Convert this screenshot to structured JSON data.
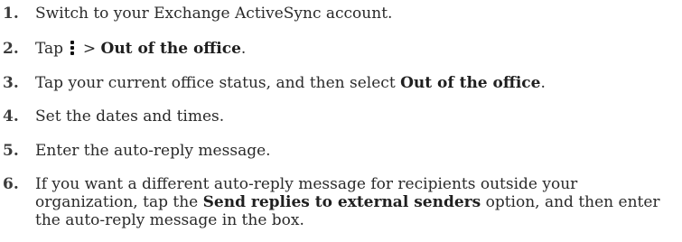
{
  "steps": [
    {
      "number": "1.",
      "text": "Switch to your Exchange ActiveSync account."
    },
    {
      "number": "2.",
      "before": "Tap ",
      "icon": "overflow-menu-icon",
      "separator": " > ",
      "bold": "Out of the office",
      "after": "."
    },
    {
      "number": "3.",
      "before": "Tap your current office status, and then select ",
      "bold": "Out of the office",
      "after": "."
    },
    {
      "number": "4.",
      "text": "Set the dates and times."
    },
    {
      "number": "5.",
      "text": "Enter the auto-reply message."
    },
    {
      "number": "6.",
      "before": "If you want a different auto-reply message for recipients outside your organization, tap the ",
      "bold": "Send replies to external senders",
      "after": " option, and then enter the auto-reply message in the box."
    }
  ]
}
